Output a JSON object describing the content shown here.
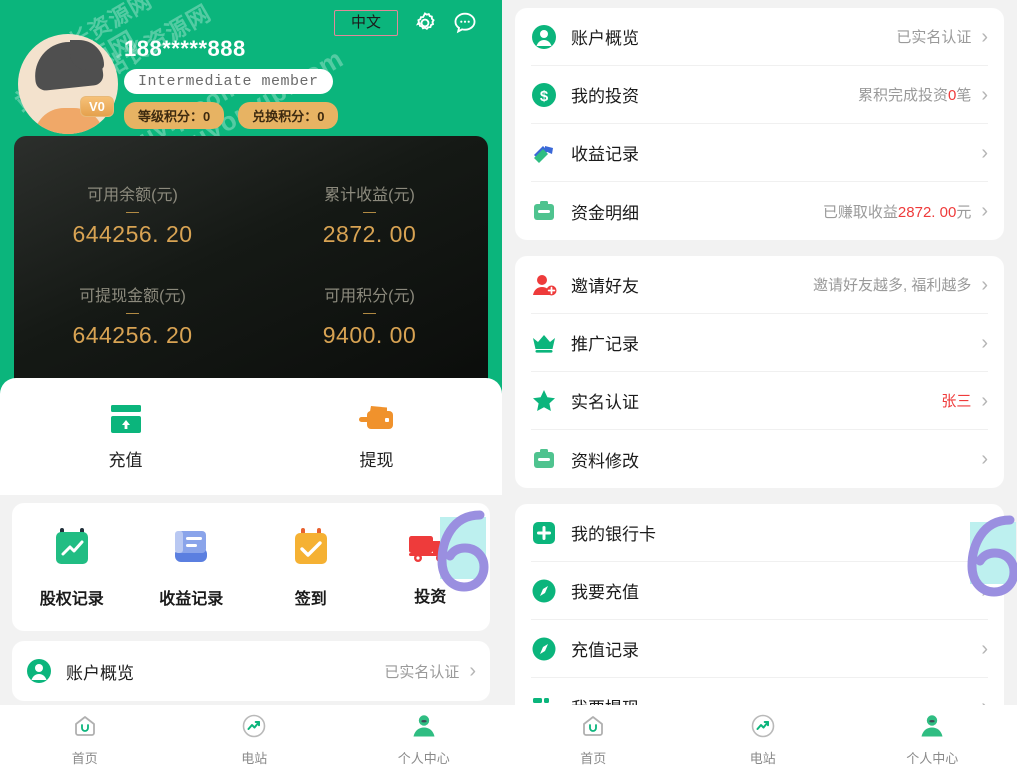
{
  "header": {
    "lang_button": "中文",
    "gear_icon": "gear-icon",
    "chat_icon": "chat-bubble-icon"
  },
  "profile": {
    "phone": "188*****888",
    "member_level": "Intermediate member",
    "level_badge": "V0",
    "points": [
      {
        "label": "等级积分：0"
      },
      {
        "label": "兑换积分：0"
      }
    ]
  },
  "balance": {
    "cells": [
      {
        "label": "可用余额(元)",
        "value": "644256. 20"
      },
      {
        "label": "累计收益(元)",
        "value": "2872. 00"
      },
      {
        "label": "可提现金额(元)",
        "value": "644256. 20"
      },
      {
        "label": "可用积分(元)",
        "value": "9400. 00"
      }
    ]
  },
  "actions": [
    {
      "label": "充值",
      "icon": "recharge-card-icon"
    },
    {
      "label": "提现",
      "icon": "withdraw-wallet-icon"
    }
  ],
  "quick_grid": [
    {
      "label": "股权记录",
      "icon": "equity-chart-icon"
    },
    {
      "label": "收益记录",
      "icon": "earnings-document-icon"
    },
    {
      "label": "签到",
      "icon": "checkin-calendar-icon"
    },
    {
      "label": "投资",
      "icon": "investment-truck-icon"
    }
  ],
  "left_overview_row": {
    "label": "账户概览",
    "value": "已实名认证",
    "icon": "user-circle-icon"
  },
  "menu_cards": [
    {
      "rows": [
        {
          "label": "账户概览",
          "value": "已实名认证",
          "value_prefix": "",
          "value_hl": "",
          "value_suffix": "",
          "icon": "user-circle-icon",
          "icon_color": "#0bb57c"
        },
        {
          "label": "我的投资",
          "value": "",
          "value_prefix": "累积完成投资",
          "value_hl": "0",
          "value_suffix": "笔",
          "icon": "dollar-circle-icon",
          "icon_color": "#0bb57c"
        },
        {
          "label": "收益记录",
          "value": "",
          "value_prefix": "",
          "value_hl": "",
          "value_suffix": "",
          "icon": "earnings-bills-icon",
          "icon_color": "#0bb57c"
        },
        {
          "label": "资金明细",
          "value": "",
          "value_prefix": "已赚取收益",
          "value_hl": "2872. 00",
          "value_suffix": "元",
          "icon": "wallet-detail-icon",
          "icon_color": "#0bb57c"
        }
      ]
    },
    {
      "rows": [
        {
          "label": "邀请好友",
          "value": "邀请好友越多, 福利越多",
          "value_prefix": "",
          "value_hl": "",
          "value_suffix": "",
          "icon": "invite-friend-icon",
          "icon_color": "#ef3b3b"
        },
        {
          "label": "推广记录",
          "value": "",
          "value_prefix": "",
          "value_hl": "",
          "value_suffix": "",
          "icon": "crown-icon",
          "icon_color": "#0bb57c"
        },
        {
          "label": "实名认证",
          "value": "张三",
          "value_prefix": "",
          "value_hl": "",
          "value_suffix": "",
          "value_red": true,
          "icon": "star-icon",
          "icon_color": "#0bb57c"
        },
        {
          "label": "资料修改",
          "value": "",
          "value_prefix": "",
          "value_hl": "",
          "value_suffix": "",
          "icon": "profile-edit-icon",
          "icon_color": "#0bb57c"
        }
      ]
    },
    {
      "rows": [
        {
          "label": "我的银行卡",
          "value": "",
          "value_prefix": "",
          "value_hl": "",
          "value_suffix": "",
          "icon": "bank-card-plus-icon",
          "icon_color": "#0bb57c"
        },
        {
          "label": "我要充值",
          "value": "",
          "value_prefix": "",
          "value_hl": "",
          "value_suffix": "",
          "icon": "compass-recharge-icon",
          "icon_color": "#0bb57c"
        },
        {
          "label": "充值记录",
          "value": "",
          "value_prefix": "",
          "value_hl": "",
          "value_suffix": "",
          "icon": "compass-record-icon",
          "icon_color": "#0bb57c"
        },
        {
          "label": "我要提现",
          "value": "",
          "value_prefix": "",
          "value_hl": "",
          "value_suffix": "",
          "icon": "withdraw-icon",
          "icon_color": "#0bb57c"
        }
      ]
    }
  ],
  "bottom_nav": [
    {
      "label": "首页",
      "icon": "home-icon",
      "active": false
    },
    {
      "label": "电站",
      "icon": "power-station-icon",
      "active": false
    },
    {
      "label": "个人中心",
      "icon": "user-icon",
      "active": true
    }
  ],
  "watermark": {
    "line1": "douyouvip.com",
    "line2": "站长资源网"
  },
  "colors": {
    "brand_green": "#0bb57c",
    "gold": "#d8a353",
    "red": "#ef3b3b",
    "page_bg": "#f2f2f2",
    "deco_purple": "#9a8fe0",
    "deco_cyan": "#bdf0ef"
  }
}
